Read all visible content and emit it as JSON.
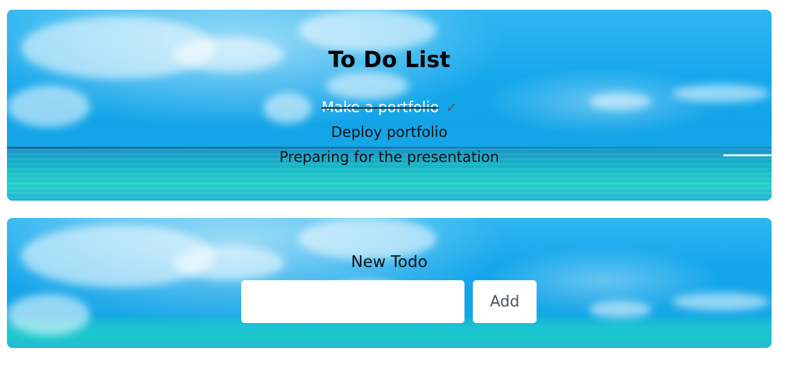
{
  "list_panel": {
    "title": "To Do List",
    "items": [
      {
        "text": "Make a portfolio",
        "done": true,
        "check_glyph": "✓",
        "icon": "checkmark-icon"
      },
      {
        "text": "Deploy portfolio",
        "done": false
      },
      {
        "text": "Preparing for the presentation",
        "done": false
      }
    ]
  },
  "form_panel": {
    "label": "New Todo",
    "input_value": "",
    "add_button_label": "Add"
  },
  "colors": {
    "sky": "#16a8ec",
    "sea": "#1cc3d5",
    "text": "#111111",
    "button_text": "#4d5660",
    "button_bg": "#ffffff"
  }
}
